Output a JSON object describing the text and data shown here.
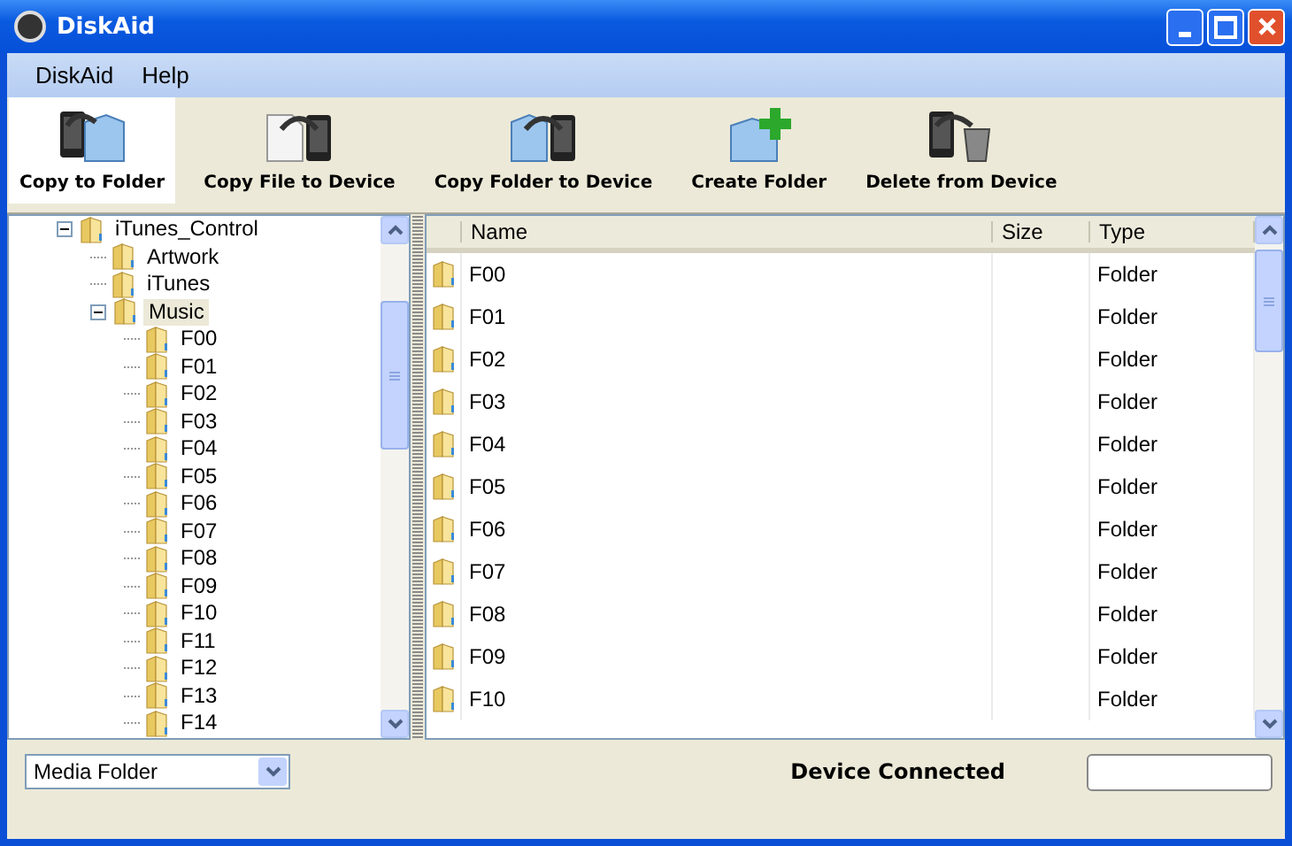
{
  "window": {
    "title": "DiskAid"
  },
  "menu": [
    "DiskAid",
    "Help"
  ],
  "toolbar": [
    {
      "label": "Copy to Folder",
      "kind": "copy-to-folder",
      "highlighted": true
    },
    {
      "label": "Copy File to Device",
      "kind": "copy-file",
      "highlighted": false
    },
    {
      "label": "Copy Folder to Device",
      "kind": "copy-folder",
      "highlighted": false
    },
    {
      "label": "Create Folder",
      "kind": "create-folder",
      "highlighted": false
    },
    {
      "label": "Delete from Device",
      "kind": "delete",
      "highlighted": false
    }
  ],
  "tree": [
    {
      "label": "iTunes_Control",
      "expanded": true,
      "selected": false,
      "children": [
        {
          "label": "Artwork",
          "selected": false
        },
        {
          "label": "iTunes",
          "selected": false
        },
        {
          "label": "Music",
          "expanded": true,
          "selected": true,
          "children": [
            {
              "label": "F00",
              "selected": false
            },
            {
              "label": "F01",
              "selected": false
            },
            {
              "label": "F02",
              "selected": false
            },
            {
              "label": "F03",
              "selected": false
            },
            {
              "label": "F04",
              "selected": false
            },
            {
              "label": "F05",
              "selected": false
            },
            {
              "label": "F06",
              "selected": false
            },
            {
              "label": "F07",
              "selected": false
            },
            {
              "label": "F08",
              "selected": false
            },
            {
              "label": "F09",
              "selected": false
            },
            {
              "label": "F10",
              "selected": false
            },
            {
              "label": "F11",
              "selected": false
            },
            {
              "label": "F12",
              "selected": false
            },
            {
              "label": "F13",
              "selected": false
            },
            {
              "label": "F14",
              "selected": false
            }
          ]
        }
      ]
    }
  ],
  "table": {
    "columns": [
      "Name",
      "Size",
      "Type"
    ],
    "rows": [
      [
        "F00",
        "",
        "Folder"
      ],
      [
        "F01",
        "",
        "Folder"
      ],
      [
        "F02",
        "",
        "Folder"
      ],
      [
        "F03",
        "",
        "Folder"
      ],
      [
        "F04",
        "",
        "Folder"
      ],
      [
        "F05",
        "",
        "Folder"
      ],
      [
        "F06",
        "",
        "Folder"
      ],
      [
        "F07",
        "",
        "Folder"
      ],
      [
        "F08",
        "",
        "Folder"
      ],
      [
        "F09",
        "",
        "Folder"
      ],
      [
        "F10",
        "",
        "Folder"
      ]
    ]
  },
  "status_bar": {
    "dropdown": "Media Folder",
    "status": "Device Connected"
  }
}
